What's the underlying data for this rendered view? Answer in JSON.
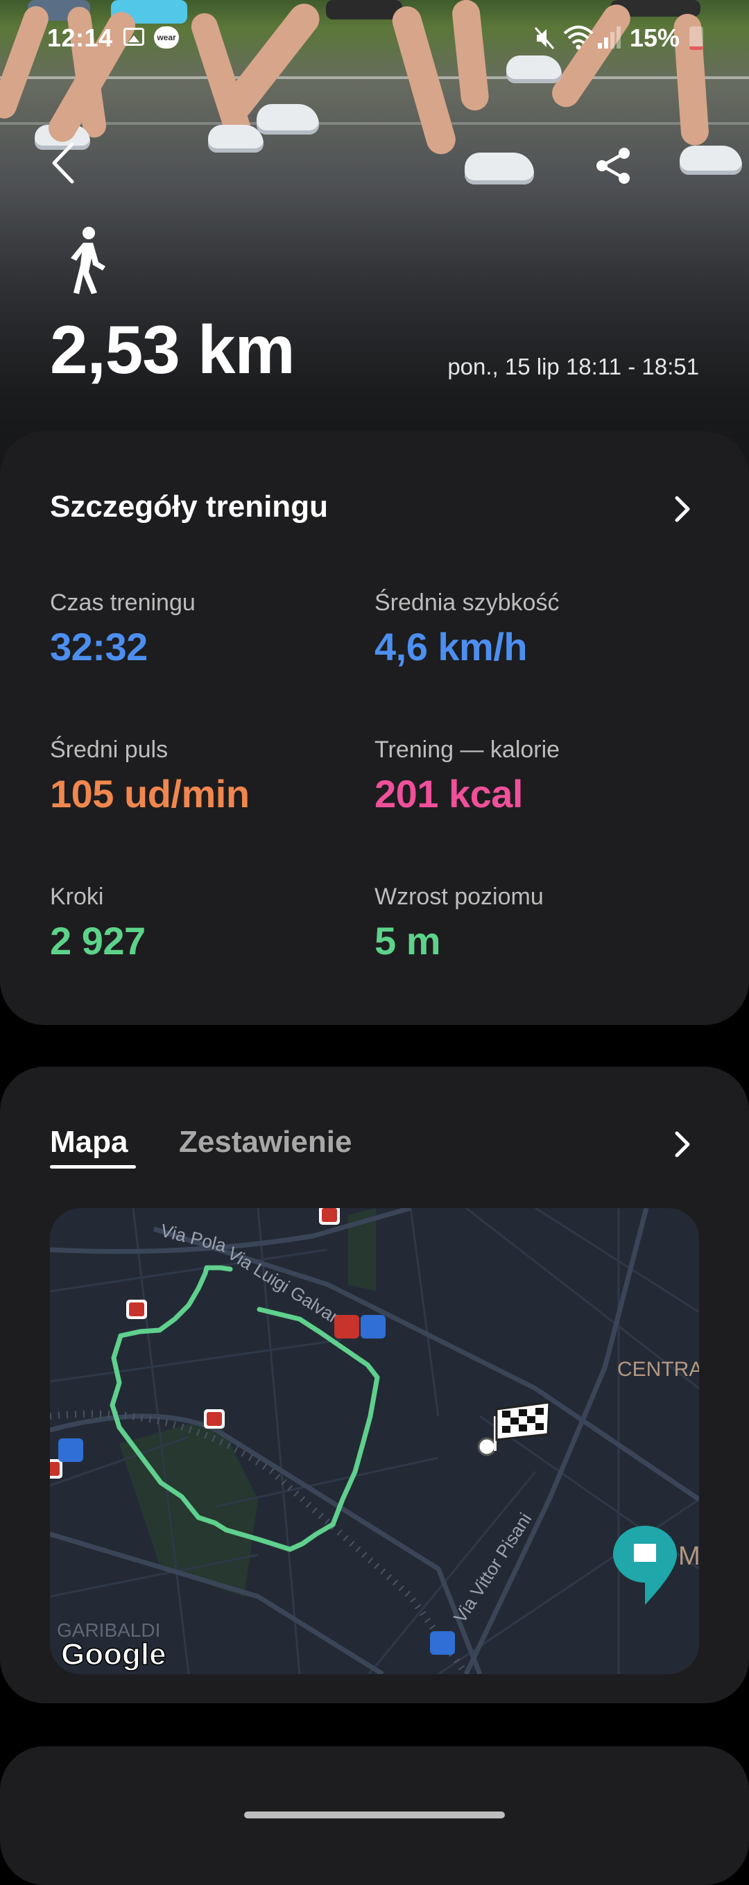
{
  "status_bar": {
    "time": "12:14",
    "wear_badge": "wear",
    "battery_text": "15%",
    "battery_level": 0.15,
    "icons": [
      "gallery-icon",
      "wear-icon",
      "mute-icon",
      "wifi-icon",
      "signal-icon",
      "battery-icon"
    ]
  },
  "header": {
    "activity_icon": "walking-icon",
    "distance": "2,53 km",
    "datetime": "pon., 15 lip 18:11 - 18:51"
  },
  "details": {
    "title": "Szczegóły treningu",
    "stats": [
      {
        "label": "Czas treningu",
        "value": "32:32",
        "color": "#4c8ff0"
      },
      {
        "label": "Średnia szybkość",
        "value": "4,6 km/h",
        "color": "#4c8ff0"
      },
      {
        "label": "Średni puls",
        "value": "105 ud/min",
        "color": "#f0874e"
      },
      {
        "label": "Trening — kalorie",
        "value": "201 kcal",
        "color": "#f0509a"
      },
      {
        "label": "Kroki",
        "value": "2 927",
        "color": "#5dd38a"
      },
      {
        "label": "Wzrost poziomu",
        "value": "5 m",
        "color": "#5dd38a"
      }
    ]
  },
  "map_section": {
    "tabs": [
      {
        "label": "Mapa",
        "active": true
      },
      {
        "label": "Zestawienie",
        "active": false
      }
    ],
    "streets": [
      "Via Pola",
      "Via Luigi Galvani",
      "Via Vittor Pisani"
    ],
    "districts": [
      "CENTRA",
      "GARIBALDI"
    ],
    "poi_letter": "M",
    "map_logo": "Google",
    "route_color": "#5fd08d"
  }
}
